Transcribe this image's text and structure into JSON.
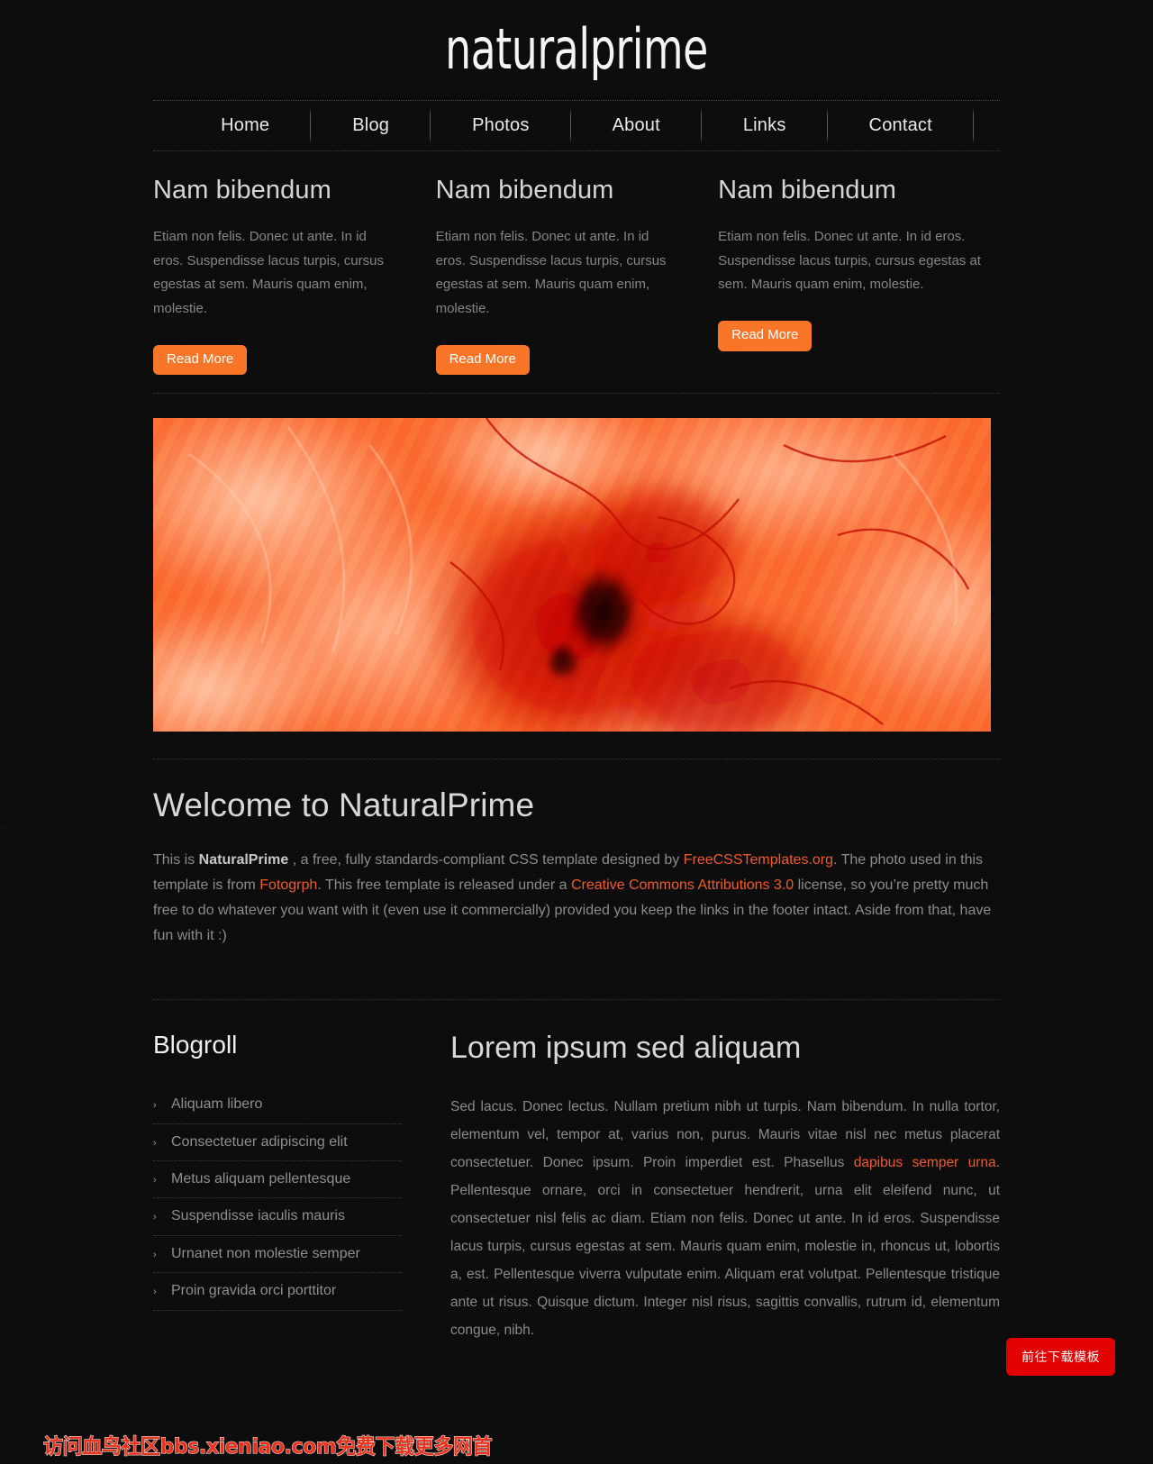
{
  "header": {
    "logo": "naturalprime"
  },
  "nav": {
    "items": [
      {
        "label": "Home"
      },
      {
        "label": "Blog"
      },
      {
        "label": "Photos"
      },
      {
        "label": "About"
      },
      {
        "label": "Links"
      },
      {
        "label": "Contact"
      }
    ]
  },
  "features": {
    "read_more_label": "Read More",
    "columns": [
      {
        "title": "Nam bibendum",
        "text": "Etiam non felis. Donec ut ante. In id eros. Suspendisse lacus turpis, cursus egestas at sem. Mauris quam enim, molestie."
      },
      {
        "title": "Nam bibendum",
        "text": "Etiam non felis. Donec ut ante. In id eros. Suspendisse lacus turpis, cursus egestas at sem. Mauris quam enim, molestie."
      },
      {
        "title": "Nam bibendum",
        "text": "Etiam non felis. Donec ut ante. In id eros. Suspendisse lacus turpis, cursus egestas at sem. Mauris quam enim, molestie."
      }
    ]
  },
  "hero": {
    "alt": "abstract orange red ink in water photograph"
  },
  "welcome": {
    "title": "Welcome to NaturalPrime",
    "p1": "This is ",
    "brand": "NaturalPrime",
    "p2": " , a free, fully standards-compliant CSS template designed by ",
    "link1": "FreeCSSTemplates.org",
    "p3": ". The photo used in this template is from ",
    "link2": "Fotogrph",
    "p4": ". This free template is released under a ",
    "link3": "Creative Commons Attributions 3.0",
    "p5": " license, so you’re pretty much free to do whatever you want with it (even use it commercially) provided you keep the links in the footer intact. Aside from that, have fun with it :)"
  },
  "blogroll": {
    "title": "Blogroll",
    "bullet": "›",
    "items": [
      {
        "label": "Aliquam libero"
      },
      {
        "label": "Consectetuer adipiscing elit"
      },
      {
        "label": "Metus aliquam pellentesque"
      },
      {
        "label": "Suspendisse iaculis mauris"
      },
      {
        "label": "Urnanet non molestie semper"
      },
      {
        "label": "Proin gravida orci porttitor"
      }
    ]
  },
  "article": {
    "title": "Lorem ipsum sed aliquam",
    "t1": "Sed lacus. Donec lectus. Nullam pretium nibh ut turpis. Nam bibendum. In nulla tortor, elementum vel, tempor at, varius non, purus. Mauris vitae nisl nec metus placerat consectetuer. Donec ipsum. Proin imperdiet est. Phasellus ",
    "link": "dapibus semper urna",
    "t2": ". Pellentesque ornare, orci in consectetuer hendrerit, urna elit eleifend nunc, ut consectetuer nisl felis ac diam. Etiam non felis. Donec ut ante. In id eros. Suspendisse lacus turpis, cursus egestas at sem. Mauris quam enim, molestie in, rhoncus ut, lobortis a, est. Pellentesque viverra vulputate enim. Aliquam erat volutpat. Pellentesque tristique ante ut risus. Quisque dictum. Integer nisl risus, sagittis convallis, rutrum id, elementum congue, nibh."
  },
  "overlay": {
    "watermark": "访问血鸟社区bbs.xieniao.com免费下载更多网首",
    "download_button": "前往下载模板"
  },
  "colors": {
    "accent_orange": "#f97528",
    "link_orange": "#f05a28",
    "watermark_red": "#e8321c",
    "button_red": "#e30000",
    "background": "#0c0c0c"
  }
}
